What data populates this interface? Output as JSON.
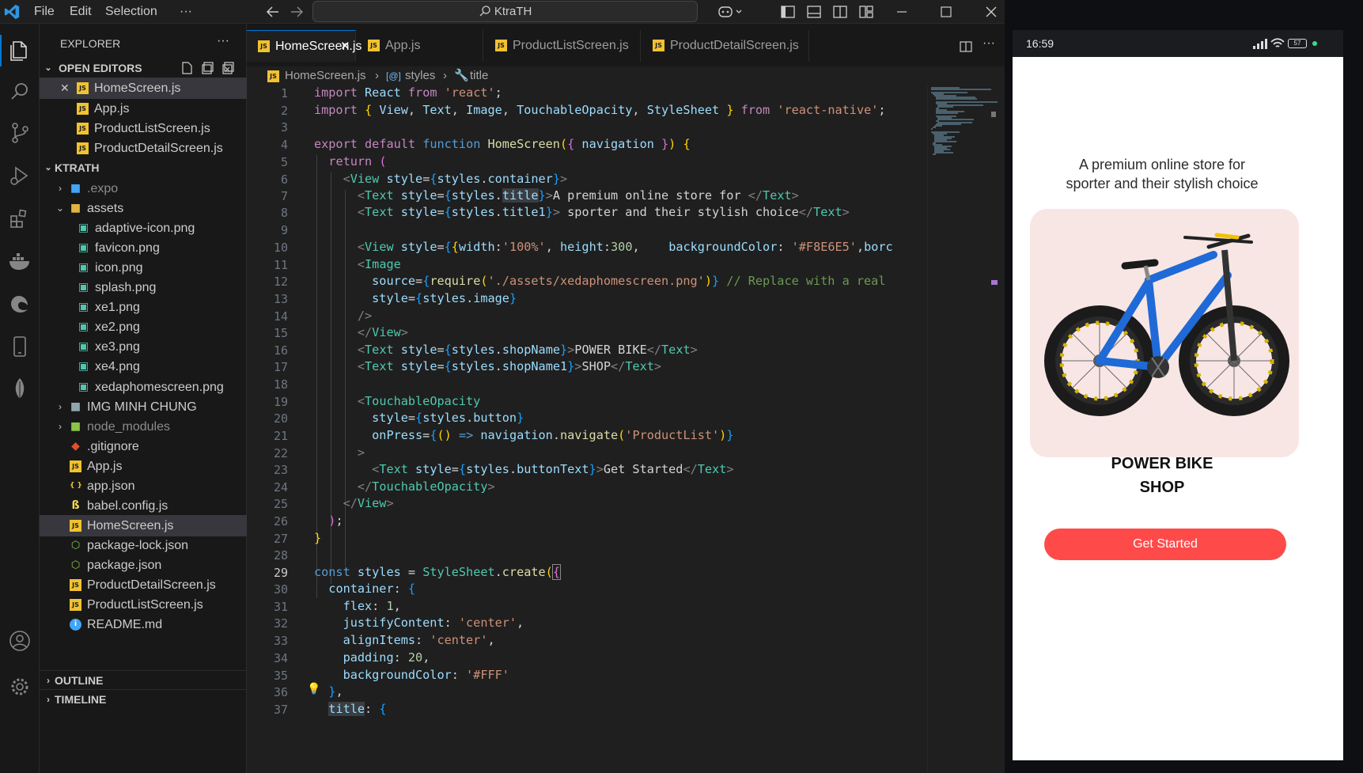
{
  "titlebar": {
    "menu": [
      "File",
      "Edit",
      "Selection",
      "···"
    ],
    "search_text": "KtraTH"
  },
  "sidebar": {
    "title": "EXPLORER",
    "more": "···",
    "open_editors_label": "OPEN EDITORS",
    "open_editors": [
      "HomeScreen.js",
      "App.js",
      "ProductListScreen.js",
      "ProductDetailScreen.js"
    ],
    "project_label": "KTRATH",
    "tree": [
      {
        "name": ".expo",
        "type": "folder"
      },
      {
        "name": "assets",
        "type": "folder-open"
      },
      {
        "name": "adaptive-icon.png",
        "type": "image"
      },
      {
        "name": "favicon.png",
        "type": "image"
      },
      {
        "name": "icon.png",
        "type": "image"
      },
      {
        "name": "splash.png",
        "type": "image"
      },
      {
        "name": "xe1.png",
        "type": "image"
      },
      {
        "name": "xe2.png",
        "type": "image"
      },
      {
        "name": "xe3.png",
        "type": "image"
      },
      {
        "name": "xe4.png",
        "type": "image"
      },
      {
        "name": "xedaphomescreen.png",
        "type": "image"
      },
      {
        "name": "IMG MINH CHUNG",
        "type": "folder"
      },
      {
        "name": "node_modules",
        "type": "folder"
      },
      {
        "name": ".gitignore",
        "type": "git"
      },
      {
        "name": "App.js",
        "type": "js"
      },
      {
        "name": "app.json",
        "type": "json"
      },
      {
        "name": "babel.config.js",
        "type": "babel"
      },
      {
        "name": "HomeScreen.js",
        "type": "js"
      },
      {
        "name": "package-lock.json",
        "type": "npm"
      },
      {
        "name": "package.json",
        "type": "npm"
      },
      {
        "name": "ProductDetailScreen.js",
        "type": "js"
      },
      {
        "name": "ProductListScreen.js",
        "type": "js"
      },
      {
        "name": "README.md",
        "type": "info"
      }
    ],
    "outline_label": "OUTLINE",
    "timeline_label": "TIMELINE"
  },
  "tabs": [
    {
      "label": "HomeScreen.js",
      "active": true
    },
    {
      "label": "App.js",
      "active": false
    },
    {
      "label": "ProductListScreen.js",
      "active": false
    },
    {
      "label": "ProductDetailScreen.js",
      "active": false
    }
  ],
  "breadcrumb": {
    "file": "HomeScreen.js",
    "symbol1": "styles",
    "symbol2": "title"
  },
  "editor": {
    "line_numbers": [
      "1",
      "2",
      "3",
      "4",
      "5",
      "6",
      "7",
      "8",
      "9",
      "10",
      "11",
      "12",
      "13",
      "14",
      "15",
      "16",
      "17",
      "18",
      "19",
      "20",
      "21",
      "22",
      "23",
      "24",
      "25",
      "26",
      "27",
      "28",
      "29",
      "30",
      "31",
      "32",
      "33",
      "34",
      "35",
      "36",
      "37"
    ]
  },
  "phone": {
    "time": "16:59",
    "battery": "57",
    "tagline1": "A premium online store for",
    "tagline2": "sporter and their stylish choice",
    "shop_name1": "POWER BIKE",
    "shop_name2": "SHOP",
    "button": "Get Started",
    "image_bg": "#F8E6E5",
    "button_color": "#FF4A4A"
  },
  "colors": {
    "accent": "#0078d4",
    "editor_bg": "#1f1f1f",
    "sidebar_bg": "#181818"
  }
}
